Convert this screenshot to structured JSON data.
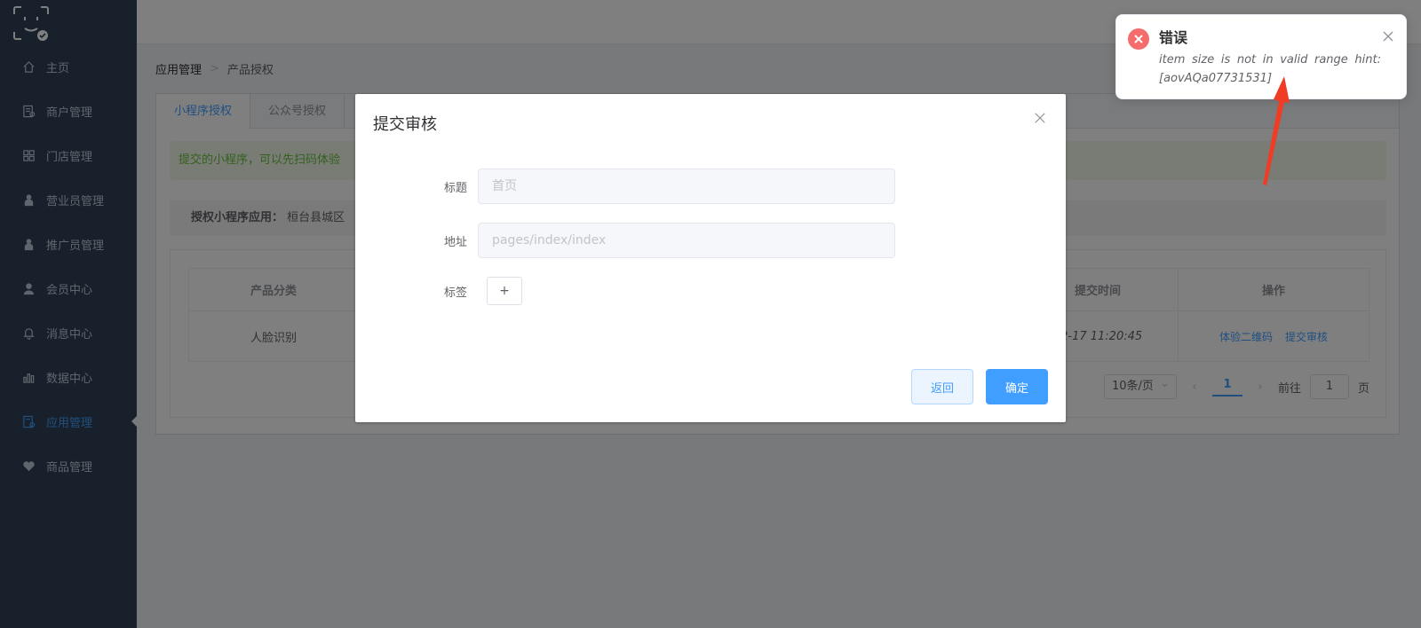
{
  "sidebar": {
    "items": [
      {
        "label": "主页",
        "icon": "home-icon"
      },
      {
        "label": "商户管理",
        "icon": "document-icon"
      },
      {
        "label": "门店管理",
        "icon": "grid-icon"
      },
      {
        "label": "营业员管理",
        "icon": "staff-icon"
      },
      {
        "label": "推广员管理",
        "icon": "staff-icon"
      },
      {
        "label": "会员中心",
        "icon": "user-icon"
      },
      {
        "label": "消息中心",
        "icon": "bell-icon"
      },
      {
        "label": "数据中心",
        "icon": "bar-chart-icon"
      },
      {
        "label": "应用管理",
        "icon": "app-icon"
      },
      {
        "label": "商品管理",
        "icon": "heart-icon"
      }
    ]
  },
  "breadcrumb": {
    "first": "应用管理",
    "second": "产品授权"
  },
  "tabs": [
    "小程序授权",
    "公众号授权"
  ],
  "alert_text": "提交的小程序，可以先扫码体验",
  "authbar": {
    "label": "授权小程序应用：",
    "value": "桓台县城区"
  },
  "table": {
    "headers": {
      "category": "产品分类",
      "time": "提交时间",
      "ops": "操作"
    },
    "row": {
      "category": "人脸识别",
      "time": "12-17 11:20:45",
      "op1": "体验二维码",
      "op2": "提交审核"
    }
  },
  "pagination": {
    "page_size": "10条/页",
    "current": "1",
    "goto_label": "前往",
    "goto_value": "1",
    "page_suffix": "页"
  },
  "dialog": {
    "title": "提交审核",
    "fields": {
      "title_label": "标题",
      "title_placeholder": "首页",
      "address_label": "地址",
      "address_placeholder": "pages/index/index",
      "tag_label": "标签",
      "tag_add": "+"
    },
    "buttons": {
      "back": "返回",
      "confirm": "确定"
    }
  },
  "notification": {
    "title": "错误",
    "message": "item size is not in valid range hint: [aovAQa07731531]",
    "color": "#f56c6c"
  },
  "colors": {
    "accent": "#409eff",
    "sidebar": "#304156",
    "success": "#67c23a",
    "danger": "#f56c6c",
    "annotation": "#f03c24"
  }
}
